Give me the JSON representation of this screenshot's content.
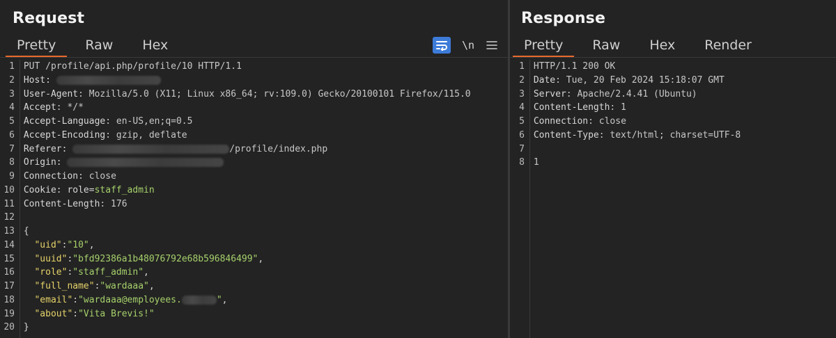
{
  "request": {
    "title": "Request",
    "tabs": [
      {
        "label": "Pretty",
        "active": true
      },
      {
        "label": "Raw",
        "active": false
      },
      {
        "label": "Hex",
        "active": false
      }
    ],
    "tools": {
      "wrap_icon": "wrap-lines-icon",
      "newline_label": "\\n",
      "menu_icon": "hamburger-menu-icon"
    },
    "lines": [
      {
        "n": "1",
        "parts": [
          {
            "t": "PUT /profile/api.php/profile/10 HTTP/1.1",
            "c": "hval"
          }
        ]
      },
      {
        "n": "2",
        "parts": [
          {
            "t": "Host",
            "c": "hkey"
          },
          {
            "t": ": ",
            "c": "punct"
          },
          {
            "redact": 150
          }
        ]
      },
      {
        "n": "3",
        "parts": [
          {
            "t": "User-Agent",
            "c": "hkey"
          },
          {
            "t": ": Mozilla/5.0 (X11; Linux x86_64; rv:109.0) Gecko/20100101 Firefox/115.0",
            "c": "hval"
          }
        ]
      },
      {
        "n": "4",
        "parts": [
          {
            "t": "Accept",
            "c": "hkey"
          },
          {
            "t": ": */*",
            "c": "hval"
          }
        ]
      },
      {
        "n": "5",
        "parts": [
          {
            "t": "Accept-Language",
            "c": "hkey"
          },
          {
            "t": ": en-US,en;q=0.5",
            "c": "hval"
          }
        ]
      },
      {
        "n": "6",
        "parts": [
          {
            "t": "Accept-Encoding",
            "c": "hkey"
          },
          {
            "t": ": gzip, deflate",
            "c": "hval"
          }
        ]
      },
      {
        "n": "7",
        "parts": [
          {
            "t": "Referer",
            "c": "hkey"
          },
          {
            "t": ": ",
            "c": "punct"
          },
          {
            "redact": 225
          },
          {
            "t": "/profile/index.php",
            "c": "hval"
          }
        ]
      },
      {
        "n": "8",
        "parts": [
          {
            "t": "Origin",
            "c": "hkey"
          },
          {
            "t": ": ",
            "c": "punct"
          },
          {
            "redact": 225
          }
        ]
      },
      {
        "n": "9",
        "parts": [
          {
            "t": "Connection",
            "c": "hkey"
          },
          {
            "t": ": close",
            "c": "hval"
          }
        ]
      },
      {
        "n": "10",
        "parts": [
          {
            "t": "Cookie",
            "c": "hkey"
          },
          {
            "t": ": ",
            "c": "punct"
          },
          {
            "t": "role",
            "c": "pkey"
          },
          {
            "t": "=",
            "c": "punct"
          },
          {
            "t": "staff_admin",
            "c": "pval"
          }
        ]
      },
      {
        "n": "11",
        "parts": [
          {
            "t": "Content-Length",
            "c": "hkey"
          },
          {
            "t": ": 176",
            "c": "hval"
          }
        ]
      },
      {
        "n": "12",
        "parts": []
      },
      {
        "n": "13",
        "parts": [
          {
            "t": "{",
            "c": "punct"
          }
        ]
      },
      {
        "n": "14",
        "parts": [
          {
            "t": "  ",
            "c": "punct"
          },
          {
            "t": "\"uid\"",
            "c": "jstr"
          },
          {
            "t": ":",
            "c": "punct"
          },
          {
            "t": "\"10\"",
            "c": "jval"
          },
          {
            "t": ",",
            "c": "punct"
          }
        ]
      },
      {
        "n": "15",
        "parts": [
          {
            "t": "  ",
            "c": "punct"
          },
          {
            "t": "\"uuid\"",
            "c": "jstr"
          },
          {
            "t": ":",
            "c": "punct"
          },
          {
            "t": "\"bfd92386a1b48076792e68b596846499\"",
            "c": "jval"
          },
          {
            "t": ",",
            "c": "punct"
          }
        ]
      },
      {
        "n": "16",
        "parts": [
          {
            "t": "  ",
            "c": "punct"
          },
          {
            "t": "\"role\"",
            "c": "jstr"
          },
          {
            "t": ":",
            "c": "punct"
          },
          {
            "t": "\"staff_admin\"",
            "c": "jval"
          },
          {
            "t": ",",
            "c": "punct"
          }
        ]
      },
      {
        "n": "17",
        "parts": [
          {
            "t": "  ",
            "c": "punct"
          },
          {
            "t": "\"full_name\"",
            "c": "jstr"
          },
          {
            "t": ":",
            "c": "punct"
          },
          {
            "t": "\"wardaaa\"",
            "c": "jval"
          },
          {
            "t": ",",
            "c": "punct"
          }
        ]
      },
      {
        "n": "18",
        "parts": [
          {
            "t": "  ",
            "c": "punct"
          },
          {
            "t": "\"email\"",
            "c": "jstr"
          },
          {
            "t": ":",
            "c": "punct"
          },
          {
            "t": "\"wardaaa@employees.",
            "c": "jval"
          },
          {
            "redact": 50
          },
          {
            "t": "\"",
            "c": "jval"
          },
          {
            "t": ",",
            "c": "punct"
          }
        ]
      },
      {
        "n": "19",
        "parts": [
          {
            "t": "  ",
            "c": "punct"
          },
          {
            "t": "\"about\"",
            "c": "jstr"
          },
          {
            "t": ":",
            "c": "punct"
          },
          {
            "t": "\"Vita Brevis!\"",
            "c": "jval"
          }
        ]
      },
      {
        "n": "20",
        "parts": [
          {
            "t": "}",
            "c": "punct"
          }
        ]
      }
    ]
  },
  "response": {
    "title": "Response",
    "tabs": [
      {
        "label": "Pretty",
        "active": true
      },
      {
        "label": "Raw",
        "active": false
      },
      {
        "label": "Hex",
        "active": false
      },
      {
        "label": "Render",
        "active": false
      }
    ],
    "lines": [
      {
        "n": "1",
        "parts": [
          {
            "t": "HTTP/1.1 200 OK",
            "c": "hval"
          }
        ]
      },
      {
        "n": "2",
        "parts": [
          {
            "t": "Date",
            "c": "hkey"
          },
          {
            "t": ": Tue, 20 Feb 2024 15:18:07 GMT",
            "c": "hval"
          }
        ]
      },
      {
        "n": "3",
        "parts": [
          {
            "t": "Server",
            "c": "hkey"
          },
          {
            "t": ": Apache/2.4.41 (Ubuntu)",
            "c": "hval"
          }
        ]
      },
      {
        "n": "4",
        "parts": [
          {
            "t": "Content-Length",
            "c": "hkey"
          },
          {
            "t": ": 1",
            "c": "hval"
          }
        ]
      },
      {
        "n": "5",
        "parts": [
          {
            "t": "Connection",
            "c": "hkey"
          },
          {
            "t": ": close",
            "c": "hval"
          }
        ]
      },
      {
        "n": "6",
        "parts": [
          {
            "t": "Content-Type",
            "c": "hkey"
          },
          {
            "t": ": text/html; charset=UTF-8",
            "c": "hval"
          }
        ]
      },
      {
        "n": "7",
        "parts": []
      },
      {
        "n": "8",
        "parts": [
          {
            "t": "1",
            "c": "hval"
          }
        ]
      }
    ]
  },
  "colors": {
    "background": "#232323",
    "active_tab_underline": "#e8692c",
    "wrap_button": "#3d7bd8",
    "json_key": "#e6d36a",
    "json_value": "#a6d16b"
  }
}
